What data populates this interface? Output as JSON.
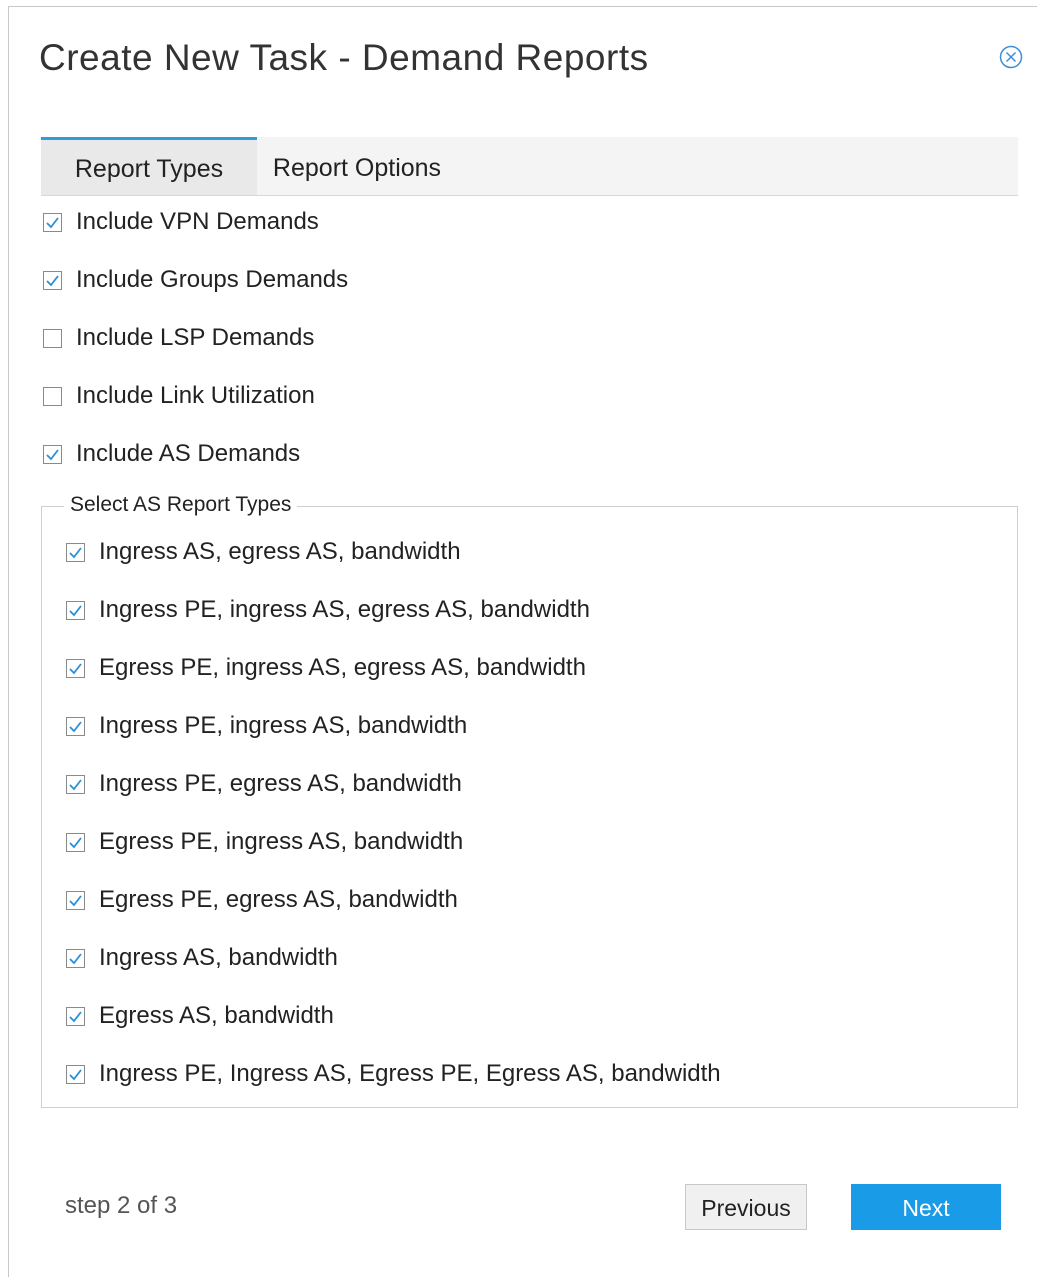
{
  "dialog": {
    "title": "Create New Task - Demand Reports",
    "close_icon": "close-circle-icon"
  },
  "tabs": [
    {
      "label": "Report Types",
      "active": true
    },
    {
      "label": "Report Options",
      "active": false
    }
  ],
  "demand_options": [
    {
      "label": "Include VPN Demands",
      "checked": true
    },
    {
      "label": "Include Groups Demands",
      "checked": true
    },
    {
      "label": "Include LSP Demands",
      "checked": false
    },
    {
      "label": "Include Link Utilization",
      "checked": false
    },
    {
      "label": "Include AS Demands",
      "checked": true
    }
  ],
  "as_report_types": {
    "legend": "Select AS Report Types",
    "items": [
      {
        "label": "Ingress AS, egress AS, bandwidth",
        "checked": true
      },
      {
        "label": "Ingress PE, ingress AS, egress AS, bandwidth",
        "checked": true
      },
      {
        "label": "Egress PE, ingress AS, egress AS, bandwidth",
        "checked": true
      },
      {
        "label": "Ingress PE, ingress AS, bandwidth",
        "checked": true
      },
      {
        "label": "Ingress PE, egress AS, bandwidth",
        "checked": true
      },
      {
        "label": "Egress PE, ingress AS, bandwidth",
        "checked": true
      },
      {
        "label": "Egress PE, egress AS, bandwidth",
        "checked": true
      },
      {
        "label": "Ingress AS, bandwidth",
        "checked": true
      },
      {
        "label": "Egress AS, bandwidth",
        "checked": true
      },
      {
        "label": "Ingress PE, Ingress AS, Egress PE, Egress AS, bandwidth",
        "checked": true
      }
    ]
  },
  "footer": {
    "step_text": "step 2 of 3",
    "previous_label": "Previous",
    "next_label": "Next"
  },
  "colors": {
    "accent": "#1a9be8",
    "tab_indicator": "#2d9fd8",
    "checkmark": "#2b8fd6"
  }
}
